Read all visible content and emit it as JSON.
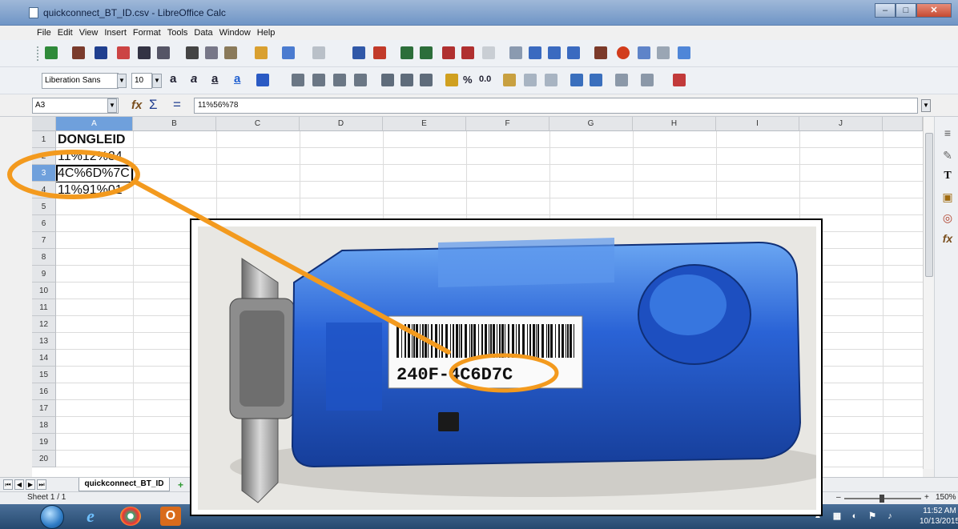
{
  "window": {
    "title": "quickconnect_BT_ID.csv - LibreOffice Calc"
  },
  "menu": [
    "File",
    "Edit",
    "View",
    "Insert",
    "Format",
    "Tools",
    "Data",
    "Window",
    "Help"
  ],
  "formatting": {
    "font_name": "Liberation Sans",
    "font_size": "10"
  },
  "formula_bar": {
    "cell_reference": "A3",
    "content": "11%56%78"
  },
  "grid": {
    "columns": [
      "A",
      "B",
      "C",
      "D",
      "E",
      "F",
      "G",
      "H",
      "I",
      "J"
    ],
    "active_column": "A",
    "rows": [
      "1",
      "2",
      "3",
      "4",
      "5",
      "6",
      "7",
      "8",
      "9",
      "10",
      "11",
      "12",
      "13",
      "14",
      "15",
      "16",
      "17",
      "18",
      "19",
      "20"
    ],
    "active_row": "3",
    "cells": {
      "A1": "DONGLEID",
      "A2": "11%12%34",
      "A3": "4C%6D%7C",
      "A4": "11%91%01"
    }
  },
  "sheets": {
    "active_tab": "quickconnect_BT_ID"
  },
  "status": {
    "sheet_info": "Sheet 1 / 1",
    "zoom": "150%"
  },
  "taskbar": {
    "time": "11:52 AM",
    "date": "10/13/2015"
  },
  "photo": {
    "label_text": "240F-4C6D7C",
    "highlight_color": "#f39a1e"
  },
  "colors": {
    "accent": "#f39a1e",
    "device_blue": "#2a5fd6"
  }
}
